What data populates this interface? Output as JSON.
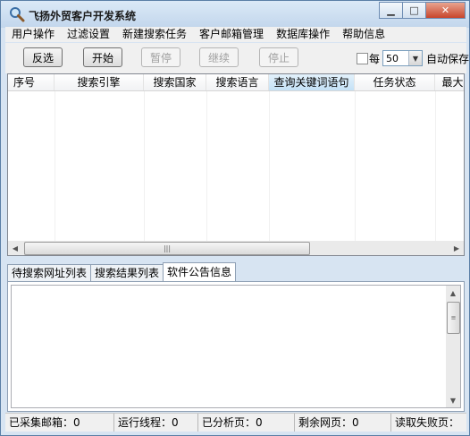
{
  "window": {
    "title": "飞扬外贸客户开发系统"
  },
  "menu": [
    "用户操作",
    "过滤设置",
    "新建搜索任务",
    "客户邮箱管理",
    "数据库操作",
    "帮助信息"
  ],
  "toolbar": {
    "buttons": [
      {
        "label": "反选",
        "enabled": true
      },
      {
        "label": "开始",
        "enabled": true
      },
      {
        "label": "暂停",
        "enabled": false
      },
      {
        "label": "继续",
        "enabled": false
      },
      {
        "label": "停止",
        "enabled": false
      }
    ],
    "every_label": "每",
    "interval_value": "50",
    "autosave_label": "自动保存"
  },
  "table": {
    "columns": [
      "序号",
      "搜索引擎",
      "搜索国家",
      "搜索语言",
      "查询关键词语句",
      "任务状态",
      "最大"
    ],
    "selected_column": 4,
    "rows": []
  },
  "tabs": [
    "待搜索网址列表",
    "搜索结果列表",
    "软件公告信息"
  ],
  "active_tab": 2,
  "status": [
    "已采集邮箱：0",
    "运行线程：0",
    "已分析页：0",
    "剩余网页：0",
    "读取失败页："
  ],
  "colors": {
    "selected_header": "#c4e1f6",
    "frame": "#d7e4f2",
    "close_button": "#c8452c"
  }
}
